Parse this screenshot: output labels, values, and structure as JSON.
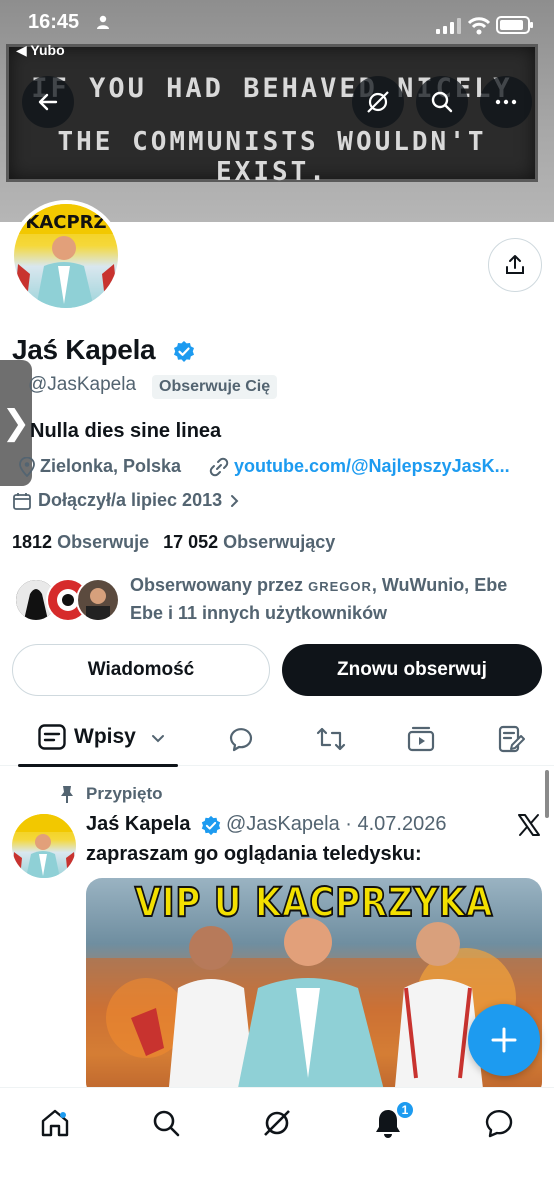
{
  "status_bar": {
    "time": "16:45",
    "back_app": "◀ Yubo"
  },
  "banner": {
    "line1": "IF YOU HAD BEHAVED NICELY",
    "line2": "THE COMMUNISTS WOULDN'T EXIST."
  },
  "profile": {
    "name": "Jaś Kapela",
    "handle": "@JasKapela",
    "follows_you": "Obserwuje Cię",
    "bio": "Nulla dies sine linea",
    "location": "Zielonka, Polska",
    "link": "youtube.com/@NajlepszyJasK...",
    "joined": "Dołączył/a lipiec 2013",
    "following_count": "1812",
    "following_label": "Obserwuje",
    "followers_count": "17 052",
    "followers_label": "Obserwujący",
    "followed_by_prefix": "Obserwowany przez",
    "followed_by_names": "GREGOR",
    "followed_by_rest": ", WuWunio, Ebe Ebe i 11 innych użytkowników"
  },
  "buttons": {
    "message": "Wiadomość",
    "follow": "Znowu obserwuj"
  },
  "tabs": {
    "active_label": "Wpisy"
  },
  "post": {
    "pinned_label": "Przypięto",
    "author": "Jaś Kapela",
    "handle_date": "@JasKapela · 4.07.2026",
    "text": "zapraszam go oglądania teledysku:",
    "image_title": "VIP U KACPRZYKA"
  },
  "nav": {
    "notifications_badge": "1"
  },
  "colors": {
    "accent": "#1d9bf0",
    "text": "#0f1419",
    "muted": "#536471"
  }
}
